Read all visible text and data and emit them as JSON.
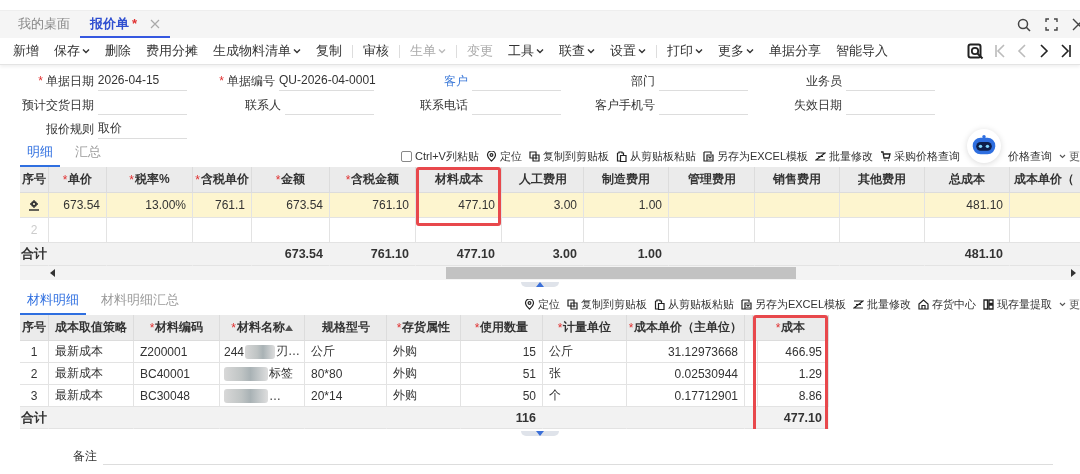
{
  "tabs": [
    {
      "label": "我的桌面",
      "selected": false,
      "closable": false
    },
    {
      "label": "报价单",
      "marker": "*",
      "selected": true,
      "closable": true
    }
  ],
  "toolbar": [
    {
      "label": "新增",
      "dropdown": false,
      "disabled": false,
      "separator_before": false
    },
    {
      "label": "保存",
      "dropdown": true,
      "disabled": false,
      "separator_before": false
    },
    {
      "label": "删除",
      "dropdown": false,
      "disabled": false,
      "separator_before": false
    },
    {
      "label": "费用分摊",
      "dropdown": false,
      "disabled": false,
      "separator_before": false
    },
    {
      "label": "生成物料清单",
      "dropdown": true,
      "disabled": false,
      "separator_before": false
    },
    {
      "label": "复制",
      "dropdown": false,
      "disabled": false,
      "separator_before": false
    },
    {
      "label": "审核",
      "dropdown": false,
      "disabled": false,
      "separator_before": true
    },
    {
      "label": "生单",
      "dropdown": true,
      "disabled": true,
      "separator_before": true
    },
    {
      "label": "变更",
      "dropdown": false,
      "disabled": true,
      "separator_before": true
    },
    {
      "label": "工具",
      "dropdown": true,
      "disabled": false,
      "separator_before": false
    },
    {
      "label": "联查",
      "dropdown": true,
      "disabled": false,
      "separator_before": false
    },
    {
      "label": "设置",
      "dropdown": true,
      "disabled": false,
      "separator_before": false
    },
    {
      "label": "打印",
      "dropdown": true,
      "disabled": false,
      "separator_before": true
    },
    {
      "label": "更多",
      "dropdown": true,
      "disabled": false,
      "separator_before": false
    },
    {
      "label": "单据分享",
      "dropdown": false,
      "disabled": false,
      "separator_before": false
    },
    {
      "label": "智能导入",
      "dropdown": false,
      "disabled": false,
      "separator_before": false
    }
  ],
  "record_nav": [
    {
      "kind": "first",
      "disabled": true
    },
    {
      "kind": "prev",
      "disabled": true
    },
    {
      "kind": "next",
      "disabled": false
    },
    {
      "kind": "last",
      "disabled": false
    }
  ],
  "form_fields": [
    {
      "marker": "*",
      "label": "单据日期",
      "link": false,
      "value": "2026-04-15"
    },
    {
      "marker": "*",
      "label": "单据编号",
      "link": false,
      "value": "QU-2026-04-0001"
    },
    {
      "label": "客户",
      "link": true
    },
    {
      "label": "部门",
      "link": false
    },
    {
      "label": "业务员",
      "link": false
    },
    {
      "label": "预计交货日期",
      "link": false
    },
    {
      "label": "联系人",
      "link": false
    },
    {
      "label": "联系电话",
      "link": false
    },
    {
      "label": "客户手机号",
      "link": false
    },
    {
      "label": "失效日期",
      "link": false
    },
    {
      "label": "报价规则",
      "link": false,
      "value": "取价"
    }
  ],
  "detail": {
    "tabs": [
      {
        "label": "明细",
        "selected": true
      },
      {
        "label": "汇总",
        "selected": false
      }
    ],
    "paste_option": {
      "label": "Ctrl+V列粘贴",
      "checked": false
    },
    "actions": [
      {
        "label": "定位",
        "kind": "locate"
      },
      {
        "label": "复制到剪贴板",
        "kind": "copy"
      },
      {
        "label": "从剪贴板粘贴",
        "kind": "paste"
      },
      {
        "label": "另存为EXCEL模板",
        "kind": "excel"
      },
      {
        "label": "批量修改",
        "kind": "batch"
      },
      {
        "label": "采购价格查询",
        "kind": "price"
      },
      {
        "label": "价格查询",
        "kind": "covered"
      }
    ],
    "more": "更",
    "table": {
      "frame_includes_totals": false,
      "columns": [
        {
          "label": "序号",
          "kind": "seq",
          "highlighted": false
        },
        {
          "marker": "*",
          "label": "单价",
          "kind": "number",
          "highlighted": false
        },
        {
          "marker": "*",
          "label": "税率%",
          "kind": "number",
          "highlighted": false
        },
        {
          "marker": "*",
          "label": "含税单价",
          "kind": "number",
          "highlighted": false
        },
        {
          "marker": "*",
          "label": "金额",
          "kind": "number",
          "highlighted": false
        },
        {
          "marker": "*",
          "label": "含税金额",
          "kind": "number",
          "highlighted": false
        },
        {
          "label": "材料成本",
          "kind": "number",
          "highlighted": true
        },
        {
          "label": "人工费用",
          "kind": "number",
          "highlighted": false
        },
        {
          "label": "制造费用",
          "kind": "number",
          "highlighted": false
        },
        {
          "label": "管理费用",
          "kind": "number",
          "highlighted": false
        },
        {
          "label": "销售费用",
          "kind": "number",
          "highlighted": false
        },
        {
          "label": "其他费用",
          "kind": "number",
          "highlighted": false
        },
        {
          "label": "总成本",
          "kind": "number",
          "highlighted": false
        },
        {
          "label": "成本单价（",
          "kind": "number",
          "highlighted": false
        }
      ],
      "rows": [
        {
          "current": true,
          "cells": [
            "",
            "673.54",
            "13.00%",
            "761.1",
            "673.54",
            "761.10",
            "477.10",
            "3.00",
            "1.00",
            "",
            "",
            "",
            "481.10"
          ]
        },
        {
          "current": false,
          "cells": [
            "2"
          ]
        }
      ],
      "totals": {
        "cells": [
          "合计",
          "",
          "",
          "",
          "673.54",
          "761.10",
          "477.10",
          "3.00",
          "1.00",
          "",
          "",
          "",
          "481.10"
        ]
      }
    }
  },
  "materials": {
    "tabs": [
      {
        "label": "材料明细",
        "selected": true
      },
      {
        "label": "材料明细汇总",
        "selected": false
      }
    ],
    "actions": [
      {
        "label": "定位",
        "kind": "locate"
      },
      {
        "label": "复制到剪贴板",
        "kind": "copy"
      },
      {
        "label": "从剪贴板粘贴",
        "kind": "paste"
      },
      {
        "label": "另存为EXCEL模板",
        "kind": "excel"
      },
      {
        "label": "批量修改",
        "kind": "batch"
      },
      {
        "label": "存货中心",
        "kind": "stock"
      },
      {
        "label": "现存量提取",
        "kind": "onhand"
      }
    ],
    "more": "更",
    "table": {
      "frame_includes_totals": true,
      "columns": [
        {
          "label": "序号",
          "kind": "seq",
          "highlighted": false
        },
        {
          "label": "成本取值策略",
          "kind": "text",
          "highlighted": false
        },
        {
          "marker": "*",
          "label": "材料编码",
          "kind": "text",
          "highlighted": false
        },
        {
          "marker": "*",
          "label": "材料名称",
          "kind": "text",
          "highlighted": false,
          "sorted_ascending": true
        },
        {
          "label": "规格型号",
          "kind": "text",
          "highlighted": false
        },
        {
          "marker": "*",
          "label": "存货属性",
          "kind": "text",
          "highlighted": false
        },
        {
          "marker": "*",
          "label": "使用数量",
          "kind": "number",
          "highlighted": false
        },
        {
          "marker": "*",
          "label": "计量单位",
          "kind": "text",
          "highlighted": false
        },
        {
          "marker": "*",
          "label": "成本单价（主单位）",
          "kind": "number",
          "highlighted": false
        },
        {
          "marker": "*",
          "label": "成本",
          "kind": "number",
          "highlighted": true,
          "gap_before": true
        }
      ],
      "rows": [
        {
          "current": false,
          "cells": [
            "1",
            "最新成本",
            "Z200001",
            {
              "before": "244",
              "after": "刃…",
              "blurred": true
            },
            "公斤",
            "外购",
            "15",
            "公斤",
            "31.12973668",
            "466.95"
          ]
        },
        {
          "current": false,
          "cells": [
            "2",
            "最新成本",
            "BC40001",
            {
              "after": "标签",
              "blurred": true
            },
            "80*80",
            "外购",
            "51",
            "张",
            "0.02530944",
            "1.29"
          ]
        },
        {
          "current": false,
          "cells": [
            "3",
            "最新成本",
            "BC30048",
            {
              "after": "…",
              "blurred": true
            },
            "20*14",
            "外购",
            "50",
            "个",
            "0.17712901",
            "8.86"
          ]
        }
      ],
      "totals": {
        "cells": [
          "合计",
          "",
          "",
          "",
          "",
          "",
          "116",
          "",
          "",
          "477.10"
        ]
      }
    }
  },
  "remark": {
    "label": "备注"
  }
}
